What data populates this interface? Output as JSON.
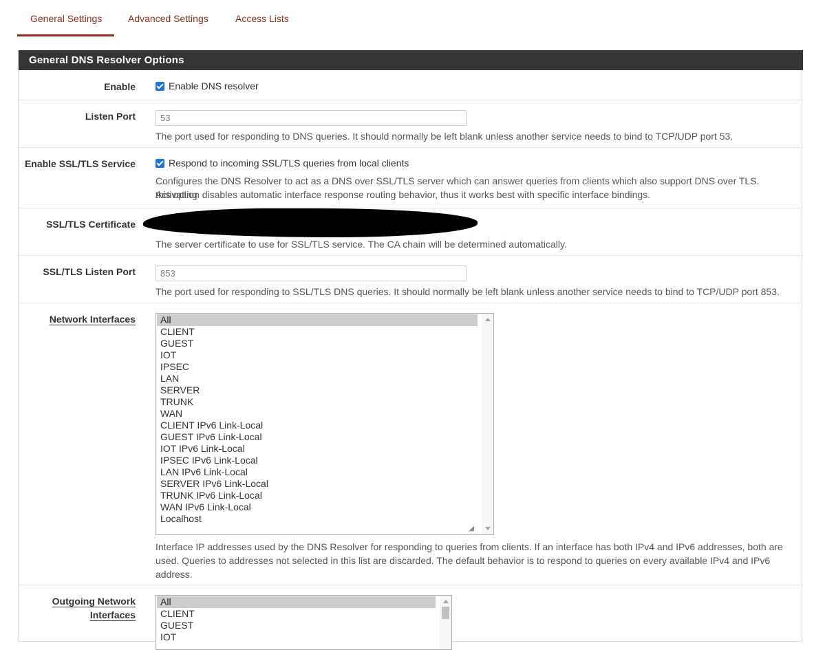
{
  "tabs": [
    {
      "label": "General Settings"
    },
    {
      "label": "Advanced Settings"
    },
    {
      "label": "Access Lists"
    }
  ],
  "panel": {
    "title": "General DNS Resolver Options"
  },
  "enable": {
    "label": "Enable",
    "checkbox_label": "Enable DNS resolver",
    "checked": true
  },
  "listen_port": {
    "label": "Listen Port",
    "placeholder": "53",
    "help": "The port used for responding to DNS queries. It should normally be left blank unless another service needs to bind to TCP/UDP port 53."
  },
  "ssl_service": {
    "label": "Enable SSL/TLS Service",
    "checkbox_label": "Respond to incoming SSL/TLS queries from local clients",
    "checked": true,
    "help_line1": "Configures the DNS Resolver to act as a DNS over SSL/TLS server which can answer queries from clients which also support DNS over TLS. Activating",
    "help_line2": "this option disables automatic interface response routing behavior, thus it works best with specific interface bindings."
  },
  "ssl_cert": {
    "label": "SSL/TLS Certificate",
    "help": "The server certificate to use for SSL/TLS service. The CA chain will be determined automatically."
  },
  "ssl_port": {
    "label": "SSL/TLS Listen Port",
    "placeholder": "853",
    "help": "The port used for responding to SSL/TLS DNS queries. It should normally be left blank unless another service needs to bind to TCP/UDP port 853."
  },
  "network_interfaces": {
    "label": "Network Interfaces",
    "options": [
      "All",
      "CLIENT",
      "GUEST",
      "IOT",
      "IPSEC",
      "LAN",
      "SERVER",
      "TRUNK",
      "WAN",
      "CLIENT IPv6 Link-Local",
      "GUEST IPv6 Link-Local",
      "IOT IPv6 Link-Local",
      "IPSEC IPv6 Link-Local",
      "LAN IPv6 Link-Local",
      "SERVER IPv6 Link-Local",
      "TRUNK IPv6 Link-Local",
      "WAN IPv6 Link-Local",
      "Localhost"
    ],
    "selected": "All",
    "help_line1": "Interface IP addresses used by the DNS Resolver for responding to queries from clients. If an interface has both IPv4 and IPv6 addresses, both are",
    "help_line2": "used. Queries to addresses not selected in this list are discarded. The default behavior is to respond to queries on every available IPv4 and IPv6",
    "help_line3": "address."
  },
  "outgoing_interfaces": {
    "label_line1": "Outgoing Network",
    "label_line2": "Interfaces",
    "options": [
      "All",
      "CLIENT",
      "GUEST",
      "IOT"
    ],
    "selected": "All"
  },
  "colors": {
    "accent": "#8f2c1f",
    "heading_bg": "#353535",
    "checkbox": "#1a73e8"
  }
}
